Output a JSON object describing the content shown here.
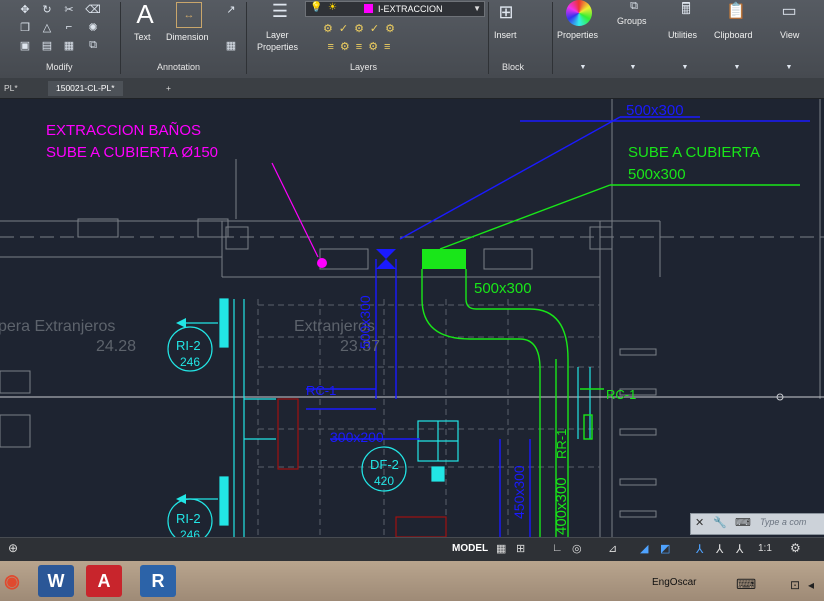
{
  "ribbon": {
    "panels": {
      "modify": "Modify",
      "annotation": "Annotation",
      "layers": "Layers",
      "block": "Block"
    },
    "buttons": {
      "text": "Text",
      "dimension": "Dimension",
      "layer_properties_1": "Layer",
      "layer_properties_2": "Properties",
      "insert": "Insert",
      "properties": "Properties",
      "groups": "Groups",
      "utilities": "Utilities",
      "clipboard": "Clipboard",
      "view": "View"
    },
    "layer_current": "I-EXTRACCION",
    "colors": {
      "layer_swatch": "#ff00ff"
    }
  },
  "tabs": [
    "PL*",
    "150021-CL-PL*",
    "+"
  ],
  "drawing": {
    "labels": {
      "extraccion_1": "EXTRACCION BAÑOS",
      "extraccion_2": "SUBE A CUBIERTA Ø150",
      "sube_1": "SUBE A CUBIERTA",
      "sube_2": "500x300",
      "duct_top": "500x300",
      "duct_green": "500x300",
      "room_1": "pera Extranjeros",
      "room_1_area": "24.28",
      "room_2": "Extranjeros",
      "room_2_area": "23.37",
      "ri2_a_top": "RI-2",
      "ri2_a_bot": "246",
      "ri2_b_top": "RI-2",
      "ri2_b_bot": "246",
      "df2_top": "DF-2",
      "df2_bot": "420",
      "rc1": "RC-1",
      "rr1": "RR-1",
      "blue_v1": "500x300",
      "blue_v2": "450x300",
      "blue_h": "300x200",
      "green_v": "400x300",
      "rc_blue": "RC-1"
    },
    "colors": {
      "magenta": "#ff00ff",
      "green": "#19e619",
      "blue": "#1a1aff",
      "cyan": "#22e5e5",
      "red": "#a01010",
      "gray": "#7a7f86"
    }
  },
  "statusbar": {
    "model": "MODEL",
    "scale": "1:1"
  },
  "commandline": {
    "placeholder": "Type a com"
  },
  "taskbar": {
    "user": "EngOscar"
  }
}
